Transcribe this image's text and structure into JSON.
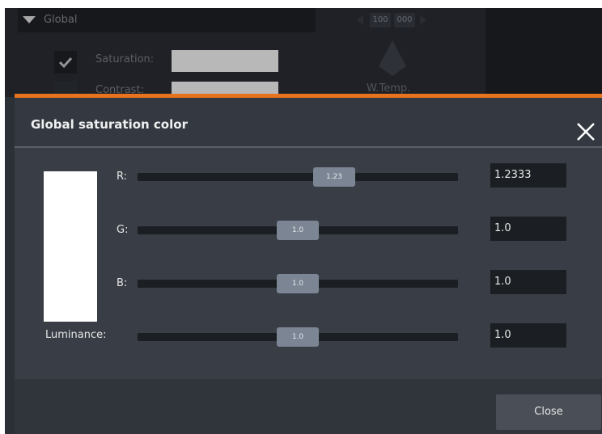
{
  "background": {
    "header_title": "Global",
    "stepper_values": [
      "100",
      "000"
    ],
    "saturation_label": "Saturation:",
    "contrast_label": "Contrast:",
    "wtemp_label": "W.Temp.",
    "saturation_checked": true
  },
  "dialog": {
    "title": "Global saturation color",
    "accent_color": "#e8731f",
    "swatch_color": "#ffffff",
    "channels": [
      {
        "label": "R:",
        "value": 1.2333,
        "value_text": "1.2333",
        "thumb_text": "1.23"
      },
      {
        "label": "G:",
        "value": 1.0,
        "value_text": "1.0",
        "thumb_text": "1.0"
      },
      {
        "label": "B:",
        "value": 1.0,
        "value_text": "1.0",
        "thumb_text": "1.0"
      },
      {
        "label": "Luminance:",
        "value": 1.0,
        "value_text": "1.0",
        "thumb_text": "1.0"
      }
    ],
    "close_button_label": "Close"
  }
}
